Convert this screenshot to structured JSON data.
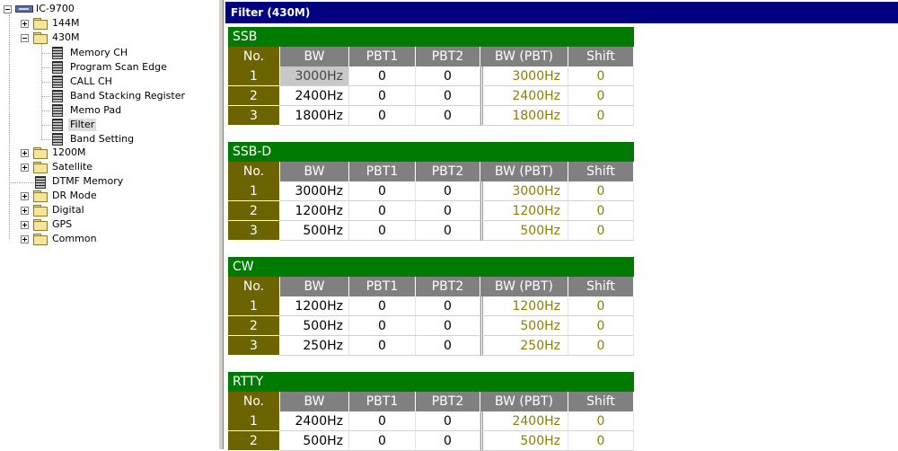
{
  "tree": {
    "root": "IC-9700",
    "items": [
      {
        "label": "144M"
      },
      {
        "label": "430M"
      },
      {
        "label": "Memory CH"
      },
      {
        "label": "Program Scan Edge"
      },
      {
        "label": "CALL CH"
      },
      {
        "label": "Band Stacking Register"
      },
      {
        "label": "Memo Pad"
      },
      {
        "label": "Filter"
      },
      {
        "label": "Band Setting"
      },
      {
        "label": "1200M"
      },
      {
        "label": "Satellite"
      },
      {
        "label": "DTMF Memory"
      },
      {
        "label": "DR Mode"
      },
      {
        "label": "Digital"
      },
      {
        "label": "GPS"
      },
      {
        "label": "Common"
      }
    ]
  },
  "panel": {
    "title": "Filter (430M)"
  },
  "headers": {
    "no": "No.",
    "bw": "BW",
    "pbt1": "PBT1",
    "pbt2": "PBT2",
    "bwpbt": "BW (PBT)",
    "shift": "Shift"
  },
  "sections": [
    {
      "title": "SSB",
      "rows": [
        {
          "no": "1",
          "bw": "3000Hz",
          "pbt1": "0",
          "pbt2": "0",
          "bwpbt": "3000Hz",
          "shift": "0"
        },
        {
          "no": "2",
          "bw": "2400Hz",
          "pbt1": "0",
          "pbt2": "0",
          "bwpbt": "2400Hz",
          "shift": "0"
        },
        {
          "no": "3",
          "bw": "1800Hz",
          "pbt1": "0",
          "pbt2": "0",
          "bwpbt": "1800Hz",
          "shift": "0"
        }
      ]
    },
    {
      "title": "SSB-D",
      "rows": [
        {
          "no": "1",
          "bw": "3000Hz",
          "pbt1": "0",
          "pbt2": "0",
          "bwpbt": "3000Hz",
          "shift": "0"
        },
        {
          "no": "2",
          "bw": "1200Hz",
          "pbt1": "0",
          "pbt2": "0",
          "bwpbt": "1200Hz",
          "shift": "0"
        },
        {
          "no": "3",
          "bw": "500Hz",
          "pbt1": "0",
          "pbt2": "0",
          "bwpbt": "500Hz",
          "shift": "0"
        }
      ]
    },
    {
      "title": "CW",
      "rows": [
        {
          "no": "1",
          "bw": "1200Hz",
          "pbt1": "0",
          "pbt2": "0",
          "bwpbt": "1200Hz",
          "shift": "0"
        },
        {
          "no": "2",
          "bw": "500Hz",
          "pbt1": "0",
          "pbt2": "0",
          "bwpbt": "500Hz",
          "shift": "0"
        },
        {
          "no": "3",
          "bw": "250Hz",
          "pbt1": "0",
          "pbt2": "0",
          "bwpbt": "250Hz",
          "shift": "0"
        }
      ]
    },
    {
      "title": "RTTY",
      "rows": [
        {
          "no": "1",
          "bw": "2400Hz",
          "pbt1": "0",
          "pbt2": "0",
          "bwpbt": "2400Hz",
          "shift": "0"
        },
        {
          "no": "2",
          "bw": "500Hz",
          "pbt1": "0",
          "pbt2": "0",
          "bwpbt": "500Hz",
          "shift": "0"
        }
      ]
    }
  ],
  "colors": {
    "section_header": "#007a00",
    "no_cell": "#6b6400",
    "column_header": "#808080",
    "title_bar": "#000080",
    "derived_text": "#8a8000"
  }
}
